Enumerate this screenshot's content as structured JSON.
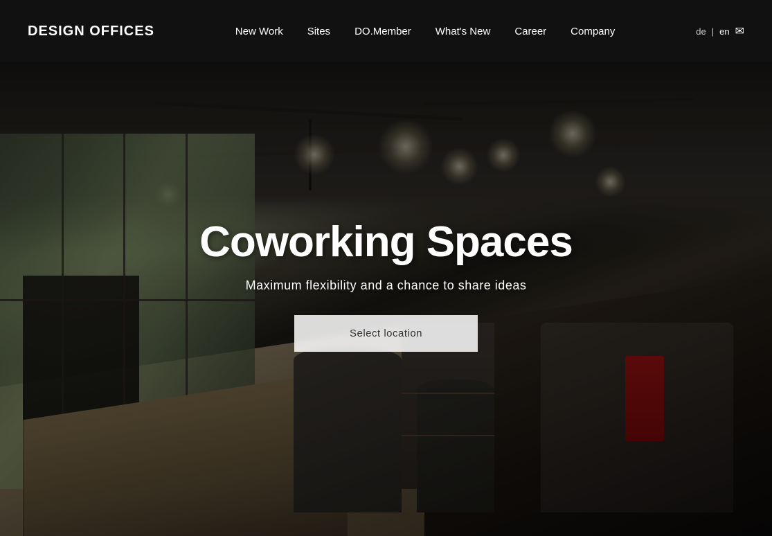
{
  "header": {
    "logo": "DESIGN OFFICES",
    "nav": {
      "items": [
        {
          "label": "New Work",
          "id": "new-work"
        },
        {
          "label": "Sites",
          "id": "sites"
        },
        {
          "label": "DO.Member",
          "id": "do-member"
        },
        {
          "label": "What's New",
          "id": "whats-new"
        },
        {
          "label": "Career",
          "id": "career"
        },
        {
          "label": "Company",
          "id": "company"
        }
      ]
    },
    "lang": {
      "de": "de",
      "separator": "|",
      "en": "en"
    },
    "mail_icon": "✉"
  },
  "hero": {
    "title": "Coworking Spaces",
    "subtitle": "Maximum flexibility and a chance to share ideas",
    "cta_label": "Select location"
  }
}
